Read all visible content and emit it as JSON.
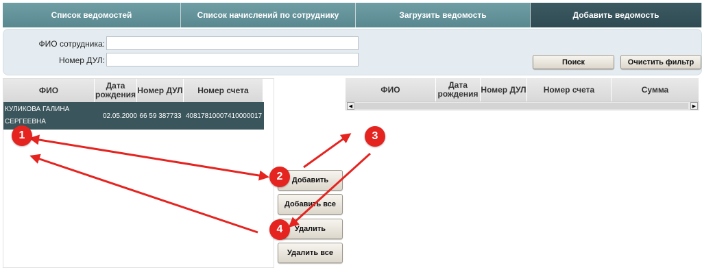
{
  "tabs": [
    {
      "label": "Список ведомостей",
      "active": false
    },
    {
      "label": "Список начислений по сотруднику",
      "active": false
    },
    {
      "label": "Загрузить ведомость",
      "active": false
    },
    {
      "label": "Добавить ведомость",
      "active": true
    }
  ],
  "filter": {
    "fio_label": "ФИО сотрудника:",
    "fio_value": "",
    "dul_label": "Номер ДУЛ:",
    "dul_value": "",
    "search_button": "Поиск",
    "clear_button": "Очистить фильтр"
  },
  "left_grid": {
    "columns": [
      "ФИО",
      "Дата рождения",
      "Номер ДУЛ",
      "Номер счета"
    ],
    "rows": [
      {
        "fio": "КУЛИКОВА ГАЛИНА СЕРГЕЕВНА",
        "birth": "02.05.2000",
        "dul": "66 59 387733",
        "account": "40817810007410000017"
      }
    ]
  },
  "right_grid": {
    "columns": [
      "ФИО",
      "Дата рождения",
      "Номер ДУЛ",
      "Номер счета",
      "Сумма"
    ],
    "rows": []
  },
  "actions": {
    "add": "Добавить",
    "add_all": "Добавить все",
    "delete": "Удалить",
    "delete_all": "Удалить все"
  },
  "annotations": {
    "color": "#e52420",
    "badges": [
      "1",
      "2",
      "3",
      "4"
    ]
  },
  "colors": {
    "tab": "#6f9ea5",
    "tab_active": "#3c5a62",
    "selected_row": "#3a555b",
    "filter_bg": "#e4ecf2"
  }
}
